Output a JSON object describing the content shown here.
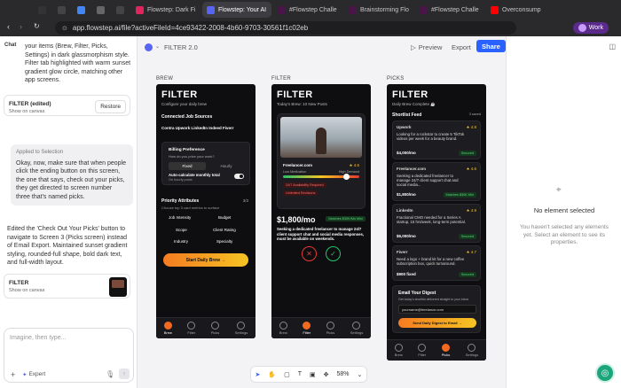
{
  "browser": {
    "tabs": [
      {
        "label": "",
        "icon": "github-icon",
        "color": "#333"
      },
      {
        "label": "",
        "icon": "notion-icon",
        "color": "#444"
      },
      {
        "label": "",
        "icon": "google-icon",
        "color": "#4285f4"
      },
      {
        "label": "",
        "icon": "dots-icon",
        "color": "#666"
      },
      {
        "label": "",
        "icon": "notion-n-icon",
        "color": "#444"
      },
      {
        "label": "Flowstep: Dark Fi",
        "icon": "flowstep-icon",
        "color": "#e0245e"
      },
      {
        "label": "Flowstep: Your AI",
        "icon": "flowstep-icon",
        "color": "#5865f2"
      },
      {
        "label": "#Flowstep Challe",
        "icon": "slack-icon",
        "color": "#4a154b"
      },
      {
        "label": "Brainstorming Flo",
        "icon": "slack-icon",
        "color": "#4a154b"
      },
      {
        "label": "#Flowstep Challe",
        "icon": "slack-icon",
        "color": "#4a154b"
      },
      {
        "label": "Overconsump",
        "icon": "youtube-icon",
        "color": "#ff0000"
      }
    ],
    "url": "app.flowstep.ai/file?activeFileId=4ce93422-2008-4b60-9703-30561f1c02eb",
    "profile": "Work"
  },
  "chat": {
    "label": "Chat",
    "intro": "your items (Brew, Filter, Picks, Settings) in dark glassmorphism style. Filter tab highlighted with warm sunset gradient glow circle, matching other app screens.",
    "card1": {
      "title": "FILTER (edited)",
      "sub": "Show on canvas",
      "button": "Restore"
    },
    "applied": "Applied to Selection",
    "user_msg": "Okay, now, make sure that when people click the ending button on this screen, the one that says, check out your picks, they get directed to screen number three that's named picks.",
    "reply": "Edited the 'Check Out Your Picks' button to navigate to Screen 3 (Picks screen) instead of Email Export. Maintained sunset gradient styling, rounded-full shape, bold dark text, and full-width layout.",
    "card2": {
      "title": "FILTER",
      "sub": "Show on canvas"
    },
    "placeholder": "Imagine, then type...",
    "expert": "Expert"
  },
  "canvas": {
    "file_title": "FILTER 2.0",
    "preview": "Preview",
    "export": "Export",
    "share": "Share",
    "zoom": "58%",
    "columns": [
      "BREW",
      "FILTER",
      "PICKS"
    ]
  },
  "brew": {
    "title": "FILTER",
    "sub": "Configure your daily brew",
    "connected_label": "Connected Job Sources",
    "sources": "Contra  Upwork  LinkedIn  Indeed  Fiverr",
    "billing_label": "Billing Preference",
    "billing_q": "How do you price your work?",
    "fixed": "Fixed",
    "hourly": "Hourly",
    "auto_label": "Auto-calculate monthly total",
    "auto_sub": "On hourly posts",
    "priority_label": "Priority Attributes",
    "priority_count": "3/3",
    "priority_sub": "Choose top 3 card metrics to surface",
    "attrs": [
      "Job Intensity",
      "Budget",
      "Scope",
      "Client Rating",
      "Industry",
      "Specialty"
    ],
    "cta": "Start Daily Brew →",
    "nav": [
      "Brew",
      "Filter",
      "Picks",
      "Settings"
    ]
  },
  "filter": {
    "title": "FILTER",
    "sub": "Today's Brew: 10 New Posts",
    "source": "Freelancer.com",
    "rating": "★ 4.6",
    "low": "Low Medication",
    "high": "High Demand",
    "tag1": "24/7 Availability Required",
    "tag2": "Unlimited Revisions",
    "price": "$1,800/mo",
    "match": "Matches $30K/Mo Mini",
    "desc": "Seeking a dedicated freelancer to manage 24/7 client support chat and social media responses, must be available on weekends.",
    "nav": [
      "Brew",
      "Filter",
      "Picks",
      "Settings"
    ]
  },
  "picks": {
    "title": "FILTER",
    "sub": "Daily Brew Complete ☕",
    "shortlist": "Shortlist Feed",
    "saved": "3 saved",
    "cards": [
      {
        "source": "Upwork",
        "rating": "★ 4.8",
        "desc": "Looking for a rockstar to create 5 TikTok videos per week for a beauty brand.",
        "price": "$4,000/mo",
        "badge": "Secured"
      },
      {
        "source": "Freelancer.com",
        "rating": "★ 4.6",
        "desc": "Seeking a dedicated freelancer to manage 24/7 client support chat and social media...",
        "price": "$1,800/mo",
        "badge": "Matches $30K Min"
      },
      {
        "source": "LinkedIn",
        "rating": "★ 4.9",
        "desc": "Fractional CMO needed for a Series A startup, 15 hrs/week, long-term potential.",
        "price": "$6,000/mo",
        "badge": "Secured"
      },
      {
        "source": "Fiverr",
        "rating": "★ 4.7",
        "desc": "Need a logo + brand kit for a new coffee subscription box, quick turnaround.",
        "price": "$900 fixed",
        "badge": "Secured"
      }
    ],
    "digest_title": "Email Your Digest",
    "digest_sub": "Get today's shortlist delivered straight to your inbox",
    "email": "yourname@freelance.com",
    "digest_btn": "Send Daily Digest to Email →",
    "nav": [
      "Brew",
      "Filter",
      "Picks",
      "Settings"
    ]
  },
  "right": {
    "title": "No element selected",
    "sub": "You haven't selected any elements yet. Select an element to see its properties."
  },
  "colors": {
    "accent": "#f26a21",
    "share": "#2962ff",
    "gold": "#f5c423"
  }
}
